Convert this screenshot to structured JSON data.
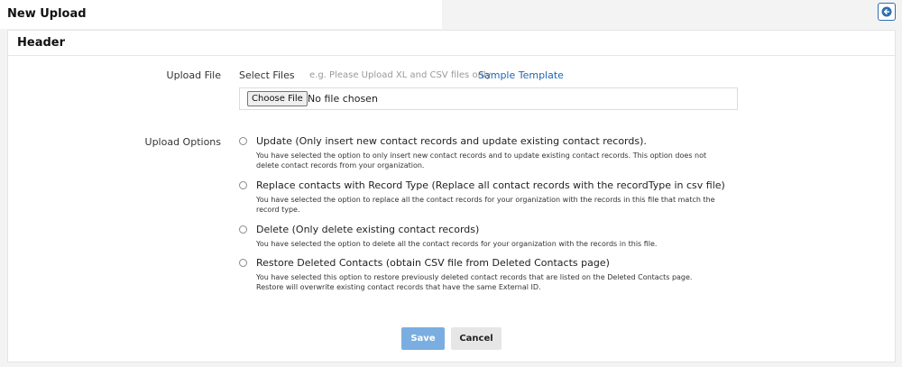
{
  "page": {
    "title": "New Upload"
  },
  "back_icon": "arrow-left-icon",
  "header": {
    "title": "Header"
  },
  "upload": {
    "label": "Upload File",
    "select_label": "Select Files",
    "hint": "e.g. Please Upload XL and CSV files only",
    "sample_link": "Sample Template",
    "choose_button": "Choose File",
    "file_status": "No file chosen"
  },
  "options": {
    "label": "Upload Options",
    "items": [
      {
        "title": "Update (Only insert new contact records and update existing contact records).",
        "desc": "You have selected the option to only insert new contact records and to update existing contact records. This option does not delete contact records from your organization."
      },
      {
        "title": "Replace contacts with Record Type (Replace all contact records with the recordType in csv file)",
        "desc": "You have selected the option to replace all the contact records for your organization with the records in this file that match the record type."
      },
      {
        "title": "Delete (Only delete existing contact records)",
        "desc": "You have selected the option to delete all the contact records for your organization with the records in this file."
      },
      {
        "title": "Restore Deleted Contacts (obtain CSV file from Deleted Contacts page)",
        "desc": "You have selected this option to restore previously deleted contact records that are listed on the Deleted Contacts page. Restore will overwrite existing contact records that have the same External ID."
      }
    ]
  },
  "actions": {
    "save": "Save",
    "cancel": "Cancel"
  },
  "colors": {
    "accent": "#2066b3",
    "save_button": "#7aaee0",
    "cancel_button": "#e6e6e6"
  }
}
